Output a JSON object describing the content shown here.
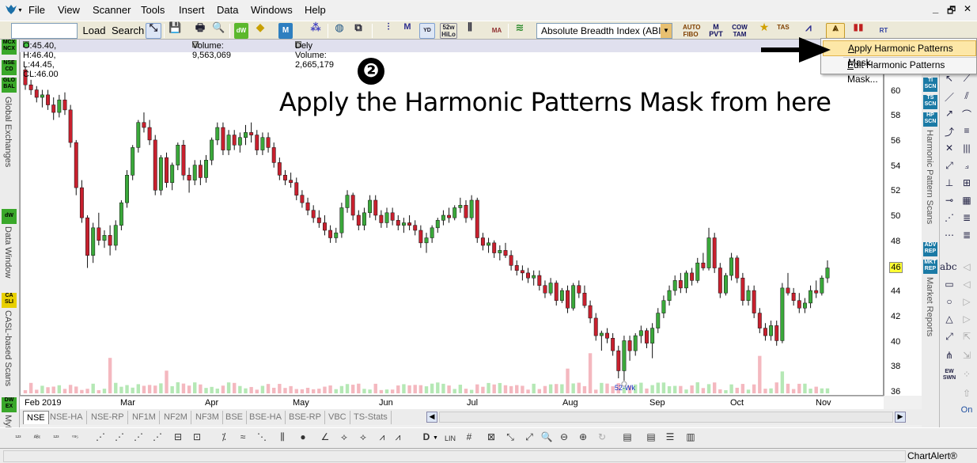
{
  "menu": {
    "items": [
      {
        "label": "File"
      },
      {
        "label": "View"
      },
      {
        "label": "Scanner"
      },
      {
        "label": "Tools"
      },
      {
        "label": "Insert"
      },
      {
        "label": "Data"
      },
      {
        "label": "Windows"
      },
      {
        "label": "Help"
      }
    ],
    "window_controls": {
      "minimize": "_",
      "restore": "🗗",
      "close": "✕"
    }
  },
  "toolbar": {
    "load_label": "Load",
    "search_label": "Search",
    "indicator_value": "Absolute Breadth Index (ABI",
    "button_texts": {
      "wk52": "52w\nHiLo",
      "ma": "MA",
      "auto_fibo": "AUTO\nFIBO",
      "pivot": "M\nPVT",
      "cow_tam": "COW\nTAM",
      "tas": "TAS",
      "rt": "RT"
    }
  },
  "context_menu": {
    "items": [
      {
        "label": "Apply Harmonic Patterns Mask",
        "highlighted": true
      },
      {
        "label": "Edit Harmonic Patterns Mask...",
        "highlighted": false
      }
    ]
  },
  "infobar": {
    "ohlc": "O:45.40, H:46.40, L:44.45, CL:46.00",
    "volume": "Volume: 9,563,069",
    "dely_volume": "Dely Volume: 2,665,179"
  },
  "annotation": {
    "step_number": "❷",
    "text": "Apply the Harmonic Patterns Mask from here"
  },
  "left_panel": {
    "badges": [
      "MCX\nNCX",
      "NSE\nCD",
      "GLO\nBAL",
      "dW",
      "CA\nSLI",
      "DW\nEX"
    ],
    "labels": [
      "Global Exchanges",
      "Data Window",
      "CASL-based Scans",
      "MyF"
    ]
  },
  "right_side_tabs": {
    "badges": [
      "TI\nSCN",
      "TS\nSCN",
      "HP\nSCN",
      "ADV\nREP",
      "MKT\nREP"
    ],
    "labels": [
      "Harmonic Pattern Scans",
      "Market Reports"
    ]
  },
  "drawing_tools": {
    "text_tool": "abc",
    "ew_label": "EW\nSWN",
    "on_label": "On"
  },
  "chart_data": {
    "type": "candlestick",
    "x_ticks": [
      "Feb 2019",
      "Mar",
      "Apr",
      "May",
      "Jun",
      "Jul",
      "Aug",
      "Sep",
      "Oct",
      "Nov"
    ],
    "y_ticks": [
      36,
      38,
      40,
      42,
      44,
      46,
      48,
      50,
      52,
      54,
      56,
      58,
      60,
      62
    ],
    "ylim": [
      36,
      62
    ],
    "last_price": "46",
    "low_marker_label": "52-Wk",
    "ohlc": [
      [
        61.8,
        62.0,
        60.2,
        60.6
      ],
      [
        60.6,
        61.0,
        59.8,
        60.2
      ],
      [
        60.2,
        60.5,
        59.2,
        59.6
      ],
      [
        59.6,
        60.2,
        58.8,
        59.8
      ],
      [
        59.8,
        60.2,
        58.6,
        59.0
      ],
      [
        59.0,
        59.6,
        57.8,
        58.4
      ],
      [
        58.4,
        59.8,
        58.0,
        59.4
      ],
      [
        59.4,
        60.0,
        58.2,
        58.6
      ],
      [
        58.6,
        59.0,
        55.6,
        56.0
      ],
      [
        56.0,
        56.2,
        51.8,
        52.4
      ],
      [
        52.4,
        53.0,
        49.6,
        50.0
      ],
      [
        50.0,
        50.2,
        46.0,
        47.0
      ],
      [
        47.0,
        49.6,
        46.4,
        49.2
      ],
      [
        49.2,
        50.4,
        47.8,
        48.2
      ],
      [
        48.2,
        49.0,
        47.6,
        48.6
      ],
      [
        48.6,
        49.4,
        47.0,
        47.8
      ],
      [
        47.8,
        49.8,
        47.4,
        49.4
      ],
      [
        49.4,
        51.4,
        49.0,
        51.2
      ],
      [
        51.2,
        53.8,
        50.8,
        53.4
      ],
      [
        53.4,
        55.8,
        53.0,
        55.6
      ],
      [
        55.6,
        57.8,
        55.2,
        57.6
      ],
      [
        57.6,
        58.4,
        56.8,
        57.2
      ],
      [
        57.2,
        57.8,
        55.8,
        56.2
      ],
      [
        56.2,
        56.6,
        51.8,
        52.2
      ],
      [
        52.2,
        55.0,
        51.8,
        54.8
      ],
      [
        54.8,
        55.2,
        52.4,
        52.8
      ],
      [
        52.8,
        54.4,
        52.2,
        54.2
      ],
      [
        54.2,
        56.0,
        53.8,
        55.8
      ],
      [
        55.8,
        56.2,
        53.0,
        53.4
      ],
      [
        53.4,
        54.0,
        52.0,
        53.0
      ],
      [
        53.0,
        54.6,
        52.6,
        54.2
      ],
      [
        54.2,
        54.6,
        52.6,
        53.2
      ],
      [
        53.2,
        55.0,
        52.8,
        54.6
      ],
      [
        54.6,
        56.4,
        54.2,
        56.2
      ],
      [
        56.2,
        57.6,
        55.8,
        57.2
      ],
      [
        57.2,
        57.6,
        55.0,
        55.4
      ],
      [
        55.4,
        57.0,
        55.0,
        56.6
      ],
      [
        56.6,
        57.0,
        55.4,
        55.8
      ],
      [
        55.8,
        56.8,
        55.2,
        56.4
      ],
      [
        56.4,
        57.4,
        55.8,
        56.8
      ],
      [
        56.8,
        57.6,
        56.0,
        56.6
      ],
      [
        56.6,
        57.0,
        55.0,
        55.4
      ],
      [
        55.4,
        56.8,
        55.0,
        56.4
      ],
      [
        56.4,
        56.8,
        55.2,
        55.6
      ],
      [
        55.6,
        56.0,
        54.0,
        54.4
      ],
      [
        54.4,
        54.8,
        53.0,
        53.4
      ],
      [
        53.4,
        53.8,
        52.6,
        53.0
      ],
      [
        53.0,
        53.6,
        52.4,
        52.8
      ],
      [
        52.8,
        53.2,
        51.4,
        51.8
      ],
      [
        51.8,
        52.2,
        50.8,
        51.2
      ],
      [
        51.2,
        51.6,
        50.2,
        50.6
      ],
      [
        50.6,
        51.0,
        49.6,
        50.0
      ],
      [
        50.0,
        50.6,
        49.2,
        49.6
      ],
      [
        49.6,
        50.2,
        48.6,
        49.0
      ],
      [
        49.0,
        49.4,
        48.0,
        48.4
      ],
      [
        48.4,
        49.2,
        48.0,
        48.8
      ],
      [
        48.8,
        51.2,
        48.4,
        50.8
      ],
      [
        50.8,
        52.2,
        50.4,
        51.8
      ],
      [
        51.8,
        52.0,
        49.8,
        50.2
      ],
      [
        50.2,
        50.6,
        49.0,
        49.4
      ],
      [
        49.4,
        50.8,
        49.0,
        50.4
      ],
      [
        50.4,
        51.8,
        50.0,
        51.4
      ],
      [
        51.4,
        51.8,
        49.8,
        50.2
      ],
      [
        50.2,
        50.6,
        49.2,
        49.6
      ],
      [
        49.6,
        50.8,
        49.2,
        50.4
      ],
      [
        50.4,
        50.8,
        49.4,
        49.8
      ],
      [
        49.8,
        50.2,
        49.0,
        49.4
      ],
      [
        49.4,
        50.0,
        48.8,
        49.6
      ],
      [
        49.6,
        50.2,
        49.0,
        49.4
      ],
      [
        49.4,
        49.8,
        48.6,
        49.0
      ],
      [
        49.0,
        49.4,
        47.6,
        48.0
      ],
      [
        48.0,
        48.8,
        47.2,
        48.4
      ],
      [
        48.4,
        49.4,
        48.0,
        49.2
      ],
      [
        49.2,
        50.0,
        48.8,
        49.8
      ],
      [
        49.8,
        50.6,
        49.4,
        50.2
      ],
      [
        50.2,
        50.8,
        49.6,
        50.0
      ],
      [
        50.0,
        51.0,
        49.8,
        50.8
      ],
      [
        50.8,
        51.6,
        50.4,
        51.0
      ],
      [
        51.0,
        51.4,
        49.6,
        50.0
      ],
      [
        50.0,
        51.8,
        49.8,
        51.4
      ],
      [
        51.4,
        51.6,
        48.0,
        48.4
      ],
      [
        48.4,
        48.8,
        47.4,
        47.8
      ],
      [
        47.8,
        48.4,
        47.2,
        48.0
      ],
      [
        48.0,
        48.2,
        46.8,
        47.2
      ],
      [
        47.2,
        47.8,
        46.6,
        47.4
      ],
      [
        47.4,
        48.0,
        46.8,
        47.0
      ],
      [
        47.0,
        47.4,
        45.8,
        46.2
      ],
      [
        46.2,
        46.6,
        45.4,
        45.8
      ],
      [
        45.8,
        46.2,
        45.0,
        45.6
      ],
      [
        45.6,
        46.0,
        44.8,
        45.2
      ],
      [
        45.2,
        45.8,
        44.6,
        45.4
      ],
      [
        45.4,
        45.8,
        44.2,
        44.6
      ],
      [
        44.6,
        45.0,
        43.6,
        44.0
      ],
      [
        44.0,
        45.2,
        43.8,
        44.8
      ],
      [
        44.8,
        45.0,
        43.0,
        43.4
      ],
      [
        43.4,
        44.4,
        43.2,
        44.2
      ],
      [
        44.2,
        44.6,
        42.4,
        42.8
      ],
      [
        42.8,
        44.8,
        42.6,
        44.6
      ],
      [
        44.6,
        45.0,
        43.6,
        44.0
      ],
      [
        44.0,
        44.6,
        42.8,
        43.0
      ],
      [
        43.0,
        43.4,
        41.6,
        42.0
      ],
      [
        42.0,
        42.4,
        40.2,
        40.6
      ],
      [
        40.6,
        41.0,
        39.4,
        40.8
      ],
      [
        40.8,
        41.2,
        40.0,
        40.4
      ],
      [
        40.4,
        40.8,
        39.0,
        39.4
      ],
      [
        39.4,
        39.8,
        37.2,
        37.8
      ],
      [
        37.8,
        40.6,
        37.0,
        40.2
      ],
      [
        40.2,
        40.6,
        38.6,
        39.4
      ],
      [
        39.4,
        40.8,
        39.0,
        40.6
      ],
      [
        40.6,
        41.4,
        40.0,
        41.0
      ],
      [
        41.0,
        41.2,
        39.6,
        40.0
      ],
      [
        40.0,
        41.6,
        38.8,
        41.2
      ],
      [
        41.2,
        42.8,
        40.8,
        42.4
      ],
      [
        42.4,
        43.8,
        42.0,
        43.4
      ],
      [
        43.4,
        44.6,
        43.0,
        44.2
      ],
      [
        44.2,
        45.4,
        43.8,
        45.0
      ],
      [
        45.0,
        45.6,
        44.0,
        44.4
      ],
      [
        44.4,
        45.8,
        44.0,
        45.6
      ],
      [
        45.6,
        46.0,
        44.6,
        45.0
      ],
      [
        45.0,
        46.8,
        44.8,
        46.4
      ],
      [
        46.4,
        47.2,
        45.8,
        46.0
      ],
      [
        46.0,
        49.2,
        45.8,
        48.4
      ],
      [
        48.4,
        48.8,
        45.6,
        46.0
      ],
      [
        46.0,
        46.4,
        43.6,
        44.0
      ],
      [
        44.0,
        45.6,
        43.8,
        45.4
      ],
      [
        45.4,
        47.2,
        45.0,
        46.8
      ],
      [
        46.8,
        47.0,
        44.8,
        45.2
      ],
      [
        45.2,
        45.6,
        43.0,
        43.4
      ],
      [
        43.4,
        44.6,
        43.0,
        44.2
      ],
      [
        44.2,
        44.6,
        42.0,
        42.4
      ],
      [
        42.4,
        42.8,
        40.8,
        41.2
      ],
      [
        41.2,
        41.6,
        40.2,
        40.6
      ],
      [
        40.6,
        41.8,
        40.2,
        41.4
      ],
      [
        41.4,
        41.8,
        39.8,
        40.2
      ],
      [
        40.2,
        44.8,
        40.0,
        44.4
      ],
      [
        44.4,
        45.6,
        43.8,
        44.0
      ],
      [
        44.0,
        44.4,
        43.0,
        43.4
      ],
      [
        43.4,
        44.0,
        42.4,
        42.8
      ],
      [
        42.8,
        43.6,
        42.4,
        43.2
      ],
      [
        43.2,
        44.6,
        42.8,
        44.2
      ],
      [
        44.2,
        45.0,
        43.6,
        44.0
      ],
      [
        44.0,
        45.4,
        43.8,
        45.2
      ],
      [
        45.2,
        46.6,
        44.8,
        46.0
      ]
    ]
  }
}
